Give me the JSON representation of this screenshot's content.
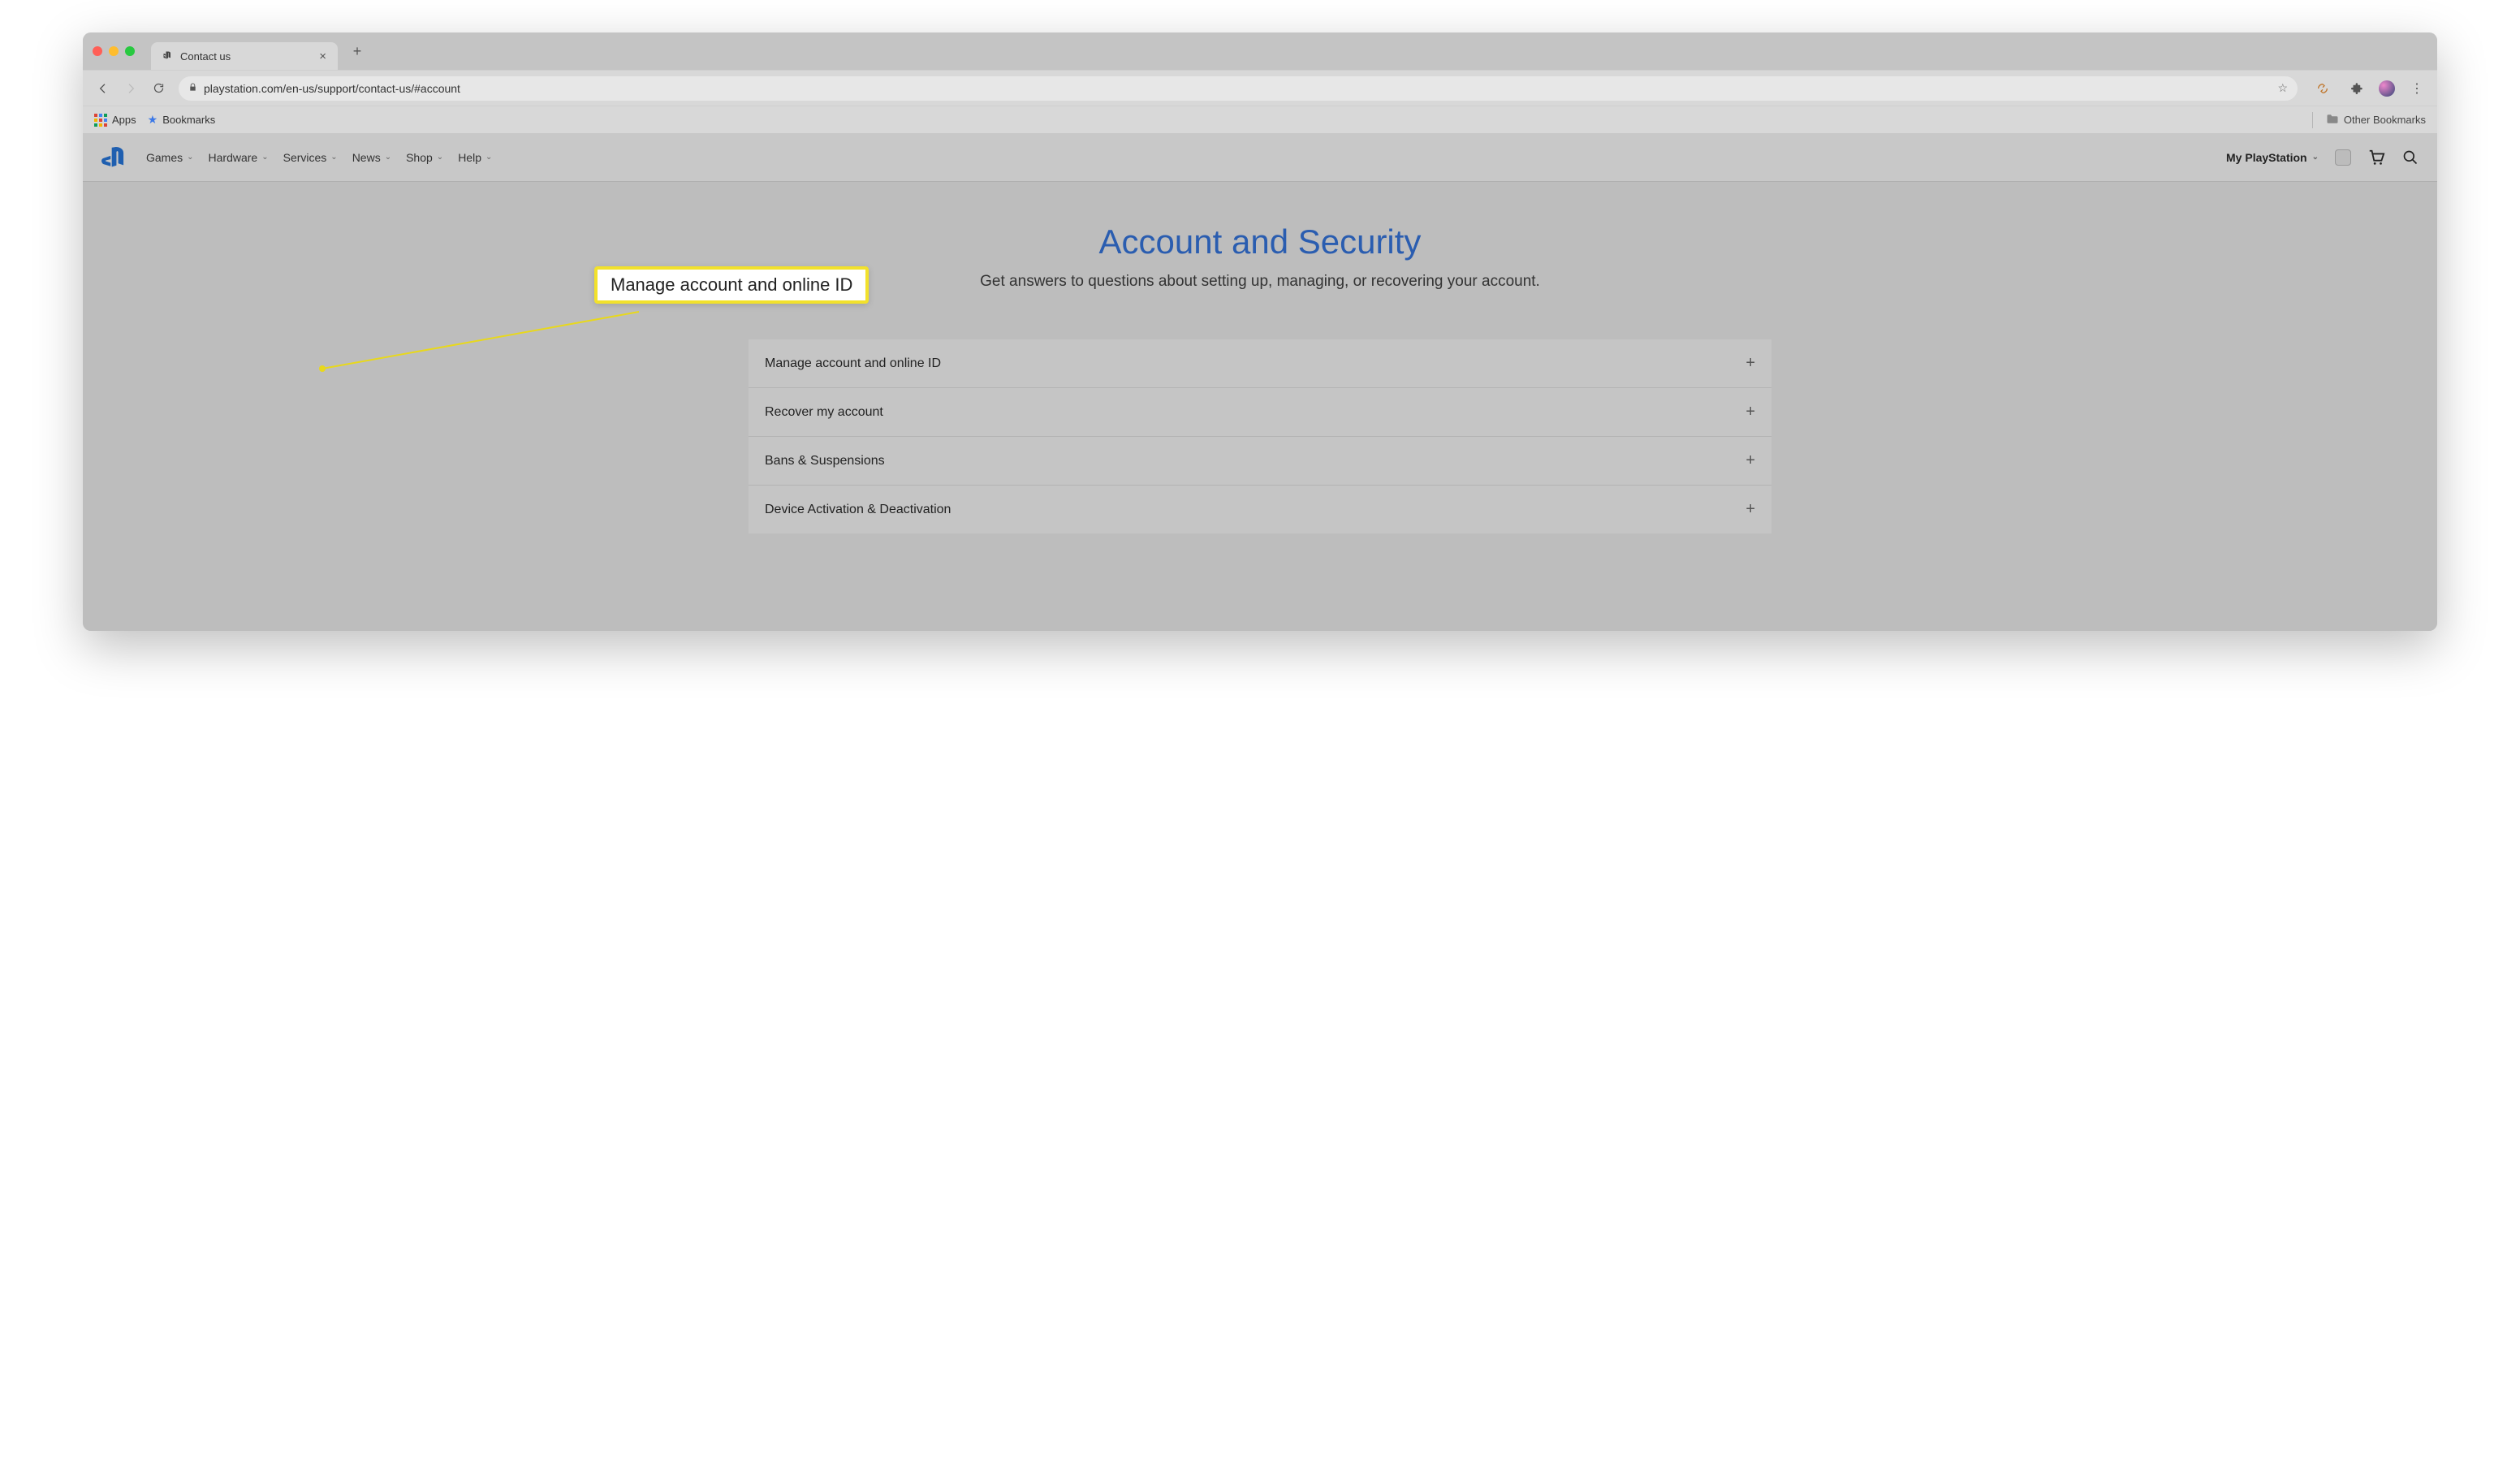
{
  "browser": {
    "tab_title": "Contact us",
    "url": "playstation.com/en-us/support/contact-us/#account",
    "bookmarks_bar": {
      "apps": "Apps",
      "bookmarks": "Bookmarks",
      "other": "Other Bookmarks"
    }
  },
  "site_nav": {
    "items": [
      "Games",
      "Hardware",
      "Services",
      "News",
      "Shop",
      "Help"
    ],
    "my_ps": "My PlayStation"
  },
  "page": {
    "title": "Account and Security",
    "subtitle": "Get answers to questions about setting up, managing, or recovering your account.",
    "accordion": [
      {
        "label": "Manage account and online ID"
      },
      {
        "label": "Recover my account"
      },
      {
        "label": "Bans & Suspensions"
      },
      {
        "label": "Device Activation & Deactivation"
      }
    ]
  },
  "annotation": {
    "callout": "Manage account and online ID"
  }
}
